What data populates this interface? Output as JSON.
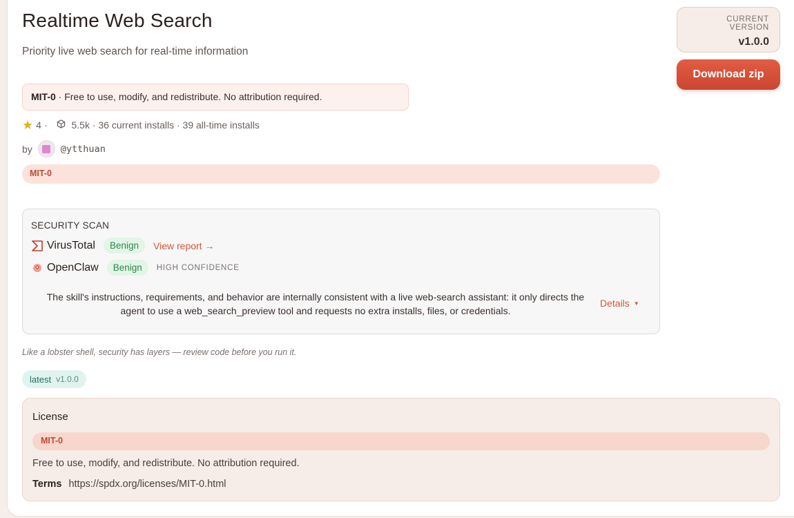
{
  "skill": {
    "title": "Realtime Web Search",
    "subtitle": "Priority live web search for real-time information"
  },
  "license_summary": {
    "name": "MIT-0",
    "text": " · Free to use, modify, and redistribute. No attribution required."
  },
  "stats": {
    "stars": "4 ·",
    "installs": "5.5k · 36 current installs · 39 all-time installs",
    "icons": [
      "star-icon",
      "package-icon"
    ]
  },
  "author": {
    "by_label": "by",
    "handle": "@ytthuan"
  },
  "tag_pill": "MIT-0",
  "security_scan": {
    "title": "SECURITY SCAN",
    "virustotal": {
      "name": "VirusTotal",
      "status": "Benign",
      "link": "View report →"
    },
    "openclaw": {
      "name": "OpenClaw",
      "status": "Benign",
      "confidence": "HIGH CONFIDENCE"
    },
    "summary": "The skill's instructions, requirements, and behavior are internally consistent with a live web-search assistant: it only directs the agent to use a web_search_preview tool and requests no extra installs, files, or credentials.",
    "details_label": "Details"
  },
  "note": "Like a lobster shell, security has layers — review code before you run it.",
  "latest_tag": {
    "label": "latest",
    "version": "v1.0.0"
  },
  "license_card": {
    "title": "License",
    "pill": "MIT-0",
    "description": "Free to use, modify, and redistribute. No attribution required.",
    "terms_label": "Terms",
    "terms_url": "https://spdx.org/licenses/MIT-0.html"
  },
  "version": {
    "label": "CURRENT VERSION",
    "value": "v1.0.0"
  },
  "download_label": "Download zip",
  "colors": {
    "accent": "#d4573a",
    "benign_bg": "#e2f5e7",
    "benign_text": "#2c8a4a"
  }
}
